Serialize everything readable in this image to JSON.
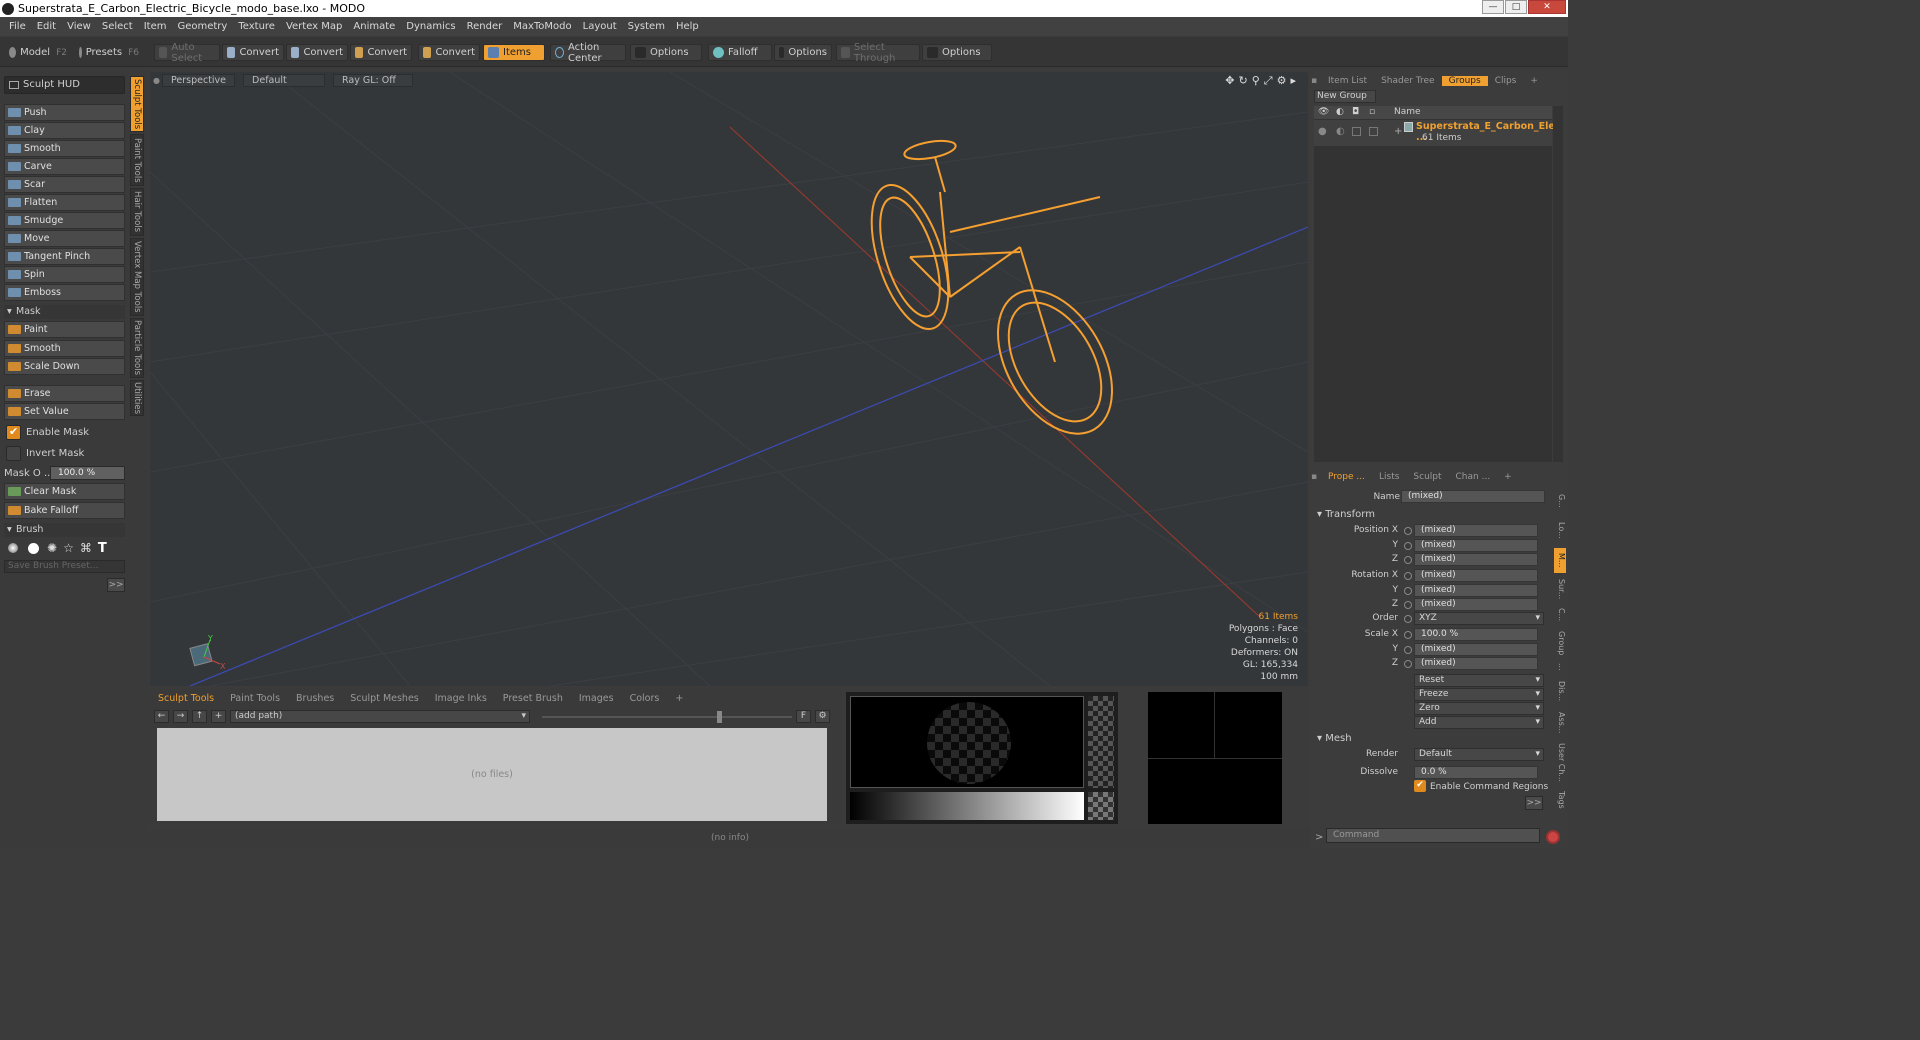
{
  "window": {
    "title": "Superstrata_E_Carbon_Electric_Bicycle_modo_base.lxo - MODO"
  },
  "menu": [
    "File",
    "Edit",
    "View",
    "Select",
    "Item",
    "Geometry",
    "Texture",
    "Vertex Map",
    "Animate",
    "Dynamics",
    "Render",
    "MaxToModo",
    "Layout",
    "System",
    "Help"
  ],
  "toolbar": {
    "model": "Model",
    "model_key": "F2",
    "presets": "Presets",
    "presets_key": "F6",
    "auto_select": "Auto Select",
    "convert": "Convert",
    "items": "Items",
    "action_center": "Action Center",
    "options": "Options",
    "falloff": "Falloff",
    "select_through": "Select Through"
  },
  "left": {
    "hud": "Sculpt HUD",
    "tools": [
      "Push",
      "Clay",
      "Smooth",
      "Carve",
      "Scar",
      "Flatten",
      "Smudge",
      "Move",
      "Tangent Pinch",
      "Spin",
      "Emboss"
    ],
    "mask_header": "Mask",
    "mask_tools": [
      "Paint",
      "Smooth",
      "Scale Down"
    ],
    "erase": "Erase",
    "set_value": "Set Value",
    "enable_mask": "Enable Mask",
    "invert_mask": "Invert Mask",
    "mask_opacity_label": "Mask O ...",
    "mask_opacity_value": "100.0 %",
    "clear_mask": "Clear Mask",
    "bake_falloff": "Bake Falloff",
    "brush_header": "Brush",
    "save_brush": "Save Brush Preset...",
    "more": ">>",
    "vtabs": [
      "Sculpt Tools",
      "Paint Tools",
      "Hair Tools",
      "Vertex Map Tools",
      "Particle Tools",
      "Utilities"
    ]
  },
  "viewport": {
    "view": "Perspective",
    "shading": "Default",
    "raygl": "Ray GL: Off",
    "stats": {
      "items": "61 Items",
      "polygons": "Polygons : Face",
      "channels": "Channels: 0",
      "deformers": "Deformers: ON",
      "gl": "GL: 165,334",
      "scale": "100 mm"
    }
  },
  "bottom": {
    "tabs": [
      "Sculpt Tools",
      "Paint Tools",
      "Brushes",
      "Sculpt Meshes",
      "Image Inks",
      "Preset Brush",
      "Images",
      "Colors",
      "+"
    ],
    "path": "(add path)",
    "nofiles": "(no files)",
    "info": "(no info)",
    "f_button": "F"
  },
  "right": {
    "tabs": [
      "Item List",
      "Shader Tree",
      "Groups",
      "Clips",
      "+"
    ],
    "new_group": "New Group",
    "name_col": "Name",
    "group_name": "Superstrata_E_Carbon_Ele ...",
    "group_count": "61 Items",
    "prop_tabs": [
      "Prope ...",
      "Lists",
      "Sculpt",
      "Chan ...",
      "+"
    ],
    "name_label": "Name",
    "name_value": "(mixed)",
    "transform": "Transform",
    "position_x": "Position X",
    "rotation_x": "Rotation X",
    "scale_x": "Scale X",
    "y": "Y",
    "z": "Z",
    "mixed": "(mixed)",
    "order_label": "Order",
    "order_value": "XYZ",
    "scale_value": "100.0 %",
    "reset": "Reset",
    "freeze": "Freeze",
    "zero": "Zero",
    "add": "Add",
    "mesh": "Mesh",
    "render_label": "Render",
    "render_value": "Default",
    "dissolve_label": "Dissolve",
    "dissolve_value": "0.0 %",
    "enable_cmd_regions": "Enable Command Regions",
    "more": ">>",
    "command": "Command",
    "side_tabs": [
      "G...",
      "Lo...",
      "M...",
      "Sur...",
      "C...",
      "Group",
      "...",
      "Dis...",
      "Ass...",
      "User Ch...",
      "Tags"
    ]
  },
  "colors": {
    "accent": "#f0a030",
    "viewport_bg": "#34373a",
    "wire": "#f5a030"
  }
}
